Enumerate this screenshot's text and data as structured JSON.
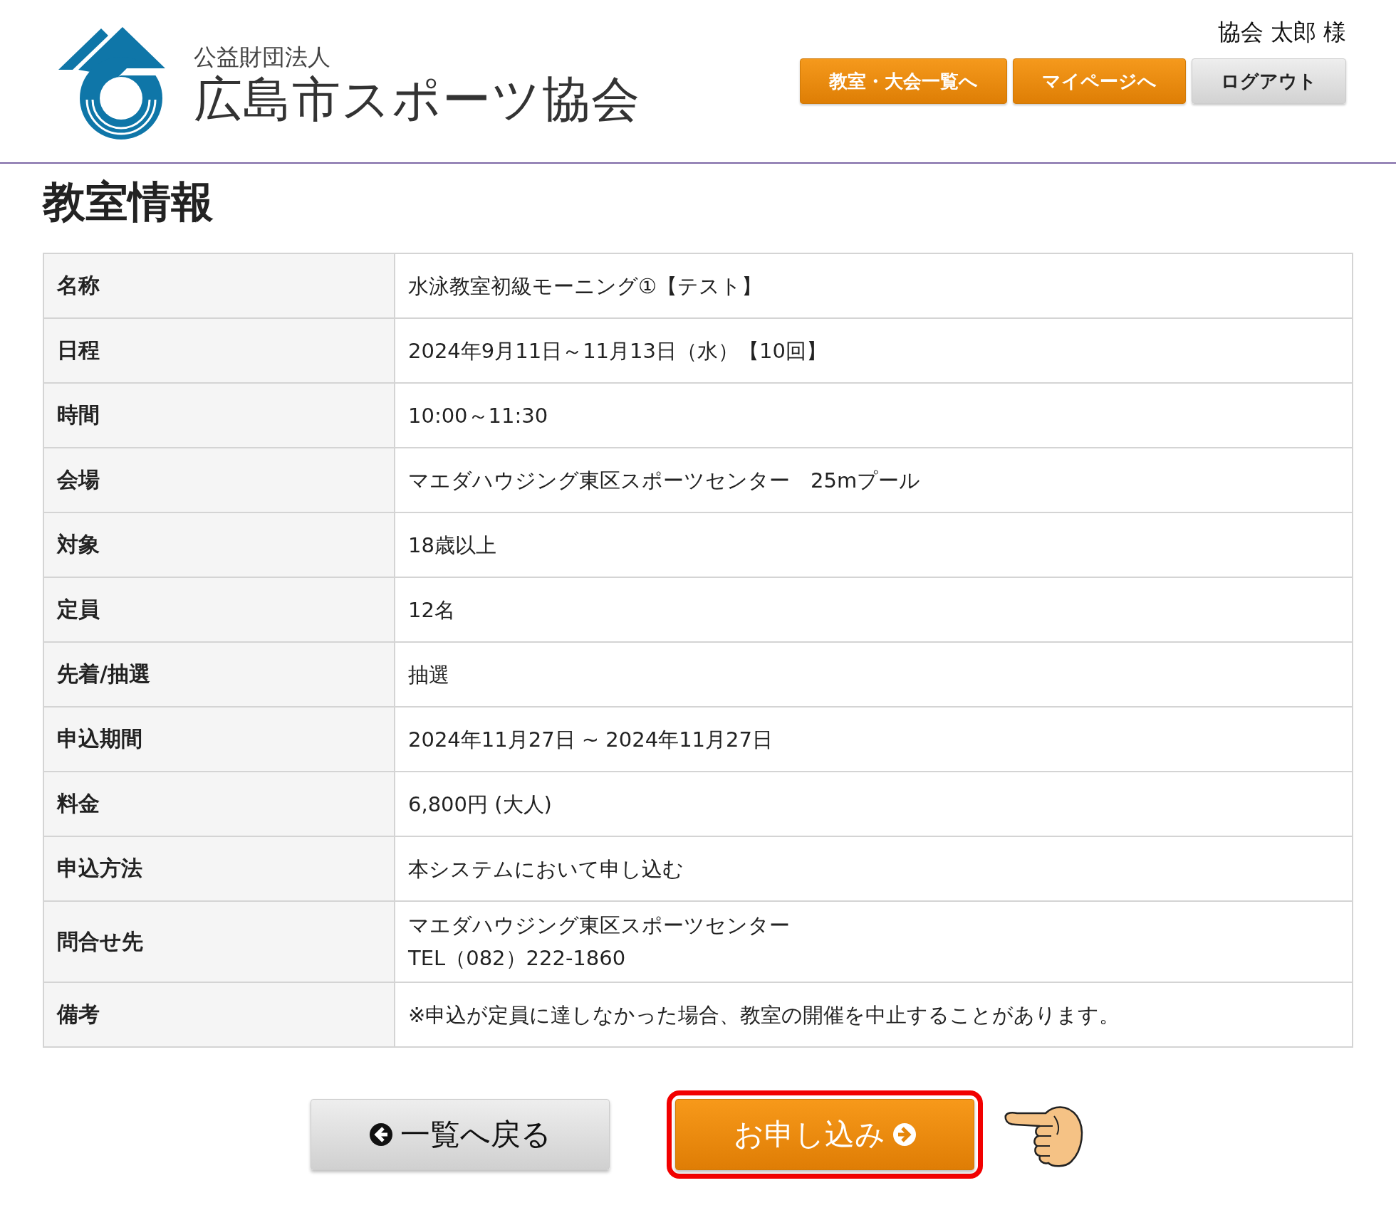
{
  "header": {
    "org_type": "公益財団法人",
    "org_name": "広島市スポーツ協会",
    "user": "協会 太郎 様",
    "nav": [
      {
        "label": "教室・大会一覧へ",
        "kind": "primary"
      },
      {
        "label": "マイページへ",
        "kind": "primary"
      },
      {
        "label": "ログアウト",
        "kind": "secondary"
      }
    ]
  },
  "title": "教室情報",
  "rows": [
    {
      "label": "名称",
      "lines": [
        "水泳教室初級モーニング①【テスト】"
      ]
    },
    {
      "label": "日程",
      "lines": [
        "2024年9月11日～11月13日（水）【10回】"
      ]
    },
    {
      "label": "時間",
      "lines": [
        "10:00～11:30"
      ]
    },
    {
      "label": "会場",
      "lines": [
        "マエダハウジング東区スポーツセンター　25mプール"
      ]
    },
    {
      "label": "対象",
      "lines": [
        "18歳以上"
      ]
    },
    {
      "label": "定員",
      "lines": [
        "12名"
      ]
    },
    {
      "label": "先着/抽選",
      "lines": [
        "抽選"
      ]
    },
    {
      "label": "申込期間",
      "lines": [
        "2024年11月27日 ~ 2024年11月27日"
      ]
    },
    {
      "label": "料金",
      "lines": [
        "6,800円 (大人)"
      ]
    },
    {
      "label": "申込方法",
      "lines": [
        "本システムにおいて申し込む"
      ]
    },
    {
      "label": "問合せ先",
      "lines": [
        "マエダハウジング東区スポーツセンター",
        "TEL（082）222-1860"
      ]
    },
    {
      "label": "備考",
      "lines": [
        "※申込が定員に達しなかった場合、教室の開催を中止することがあります。"
      ]
    }
  ],
  "actions": [
    {
      "label": "一覧へ戻る",
      "kind": "back",
      "highlighted": false
    },
    {
      "label": "お申し込み",
      "kind": "apply",
      "highlighted": true
    }
  ]
}
